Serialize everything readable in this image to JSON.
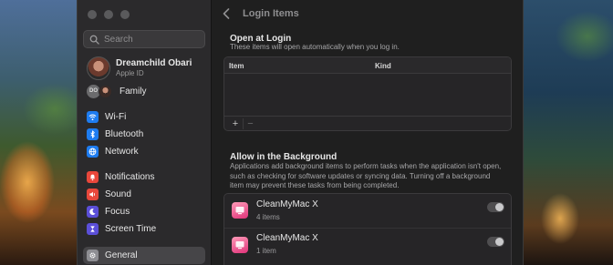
{
  "window": {
    "traffic_lights": [
      "close",
      "minimize",
      "zoom"
    ]
  },
  "sidebar": {
    "search_placeholder": "Search",
    "profile": {
      "name": "Dreamchild Obari",
      "subtitle": "Apple ID"
    },
    "family": {
      "initials": "DO",
      "label": "Family"
    },
    "items": [
      {
        "label": "Wi-Fi",
        "icon": "wifi-icon",
        "color": "#1e7cf0"
      },
      {
        "label": "Bluetooth",
        "icon": "bluetooth-icon",
        "color": "#1e7cf0"
      },
      {
        "label": "Network",
        "icon": "globe-icon",
        "color": "#1e7cf0"
      },
      {
        "label": "Notifications",
        "icon": "bell-icon",
        "color": "#e8473b"
      },
      {
        "label": "Sound",
        "icon": "speaker-icon",
        "color": "#e8473b"
      },
      {
        "label": "Focus",
        "icon": "moon-icon",
        "color": "#5b4fd8"
      },
      {
        "label": "Screen Time",
        "icon": "hourglass-icon",
        "color": "#5b4fd8"
      },
      {
        "label": "General",
        "icon": "gear-icon",
        "color": "#8e8e93",
        "selected": true
      }
    ]
  },
  "main": {
    "title": "Login Items",
    "open_at_login": {
      "title": "Open at Login",
      "description": "These items will open automatically when you log in.",
      "columns": [
        "Item",
        "Kind"
      ],
      "add_label": "+",
      "remove_label": "−"
    },
    "background": {
      "title": "Allow in the Background",
      "description": "Applications add background items to perform tasks when the application isn't open, such as checking for software updates or syncing data. Turning off a background item may prevent these tasks from being completed.",
      "items": [
        {
          "name": "CleanMyMac X",
          "detail": "4 items",
          "enabled": true
        },
        {
          "name": "CleanMyMac X",
          "detail": "1 item",
          "enabled": true
        }
      ]
    }
  }
}
